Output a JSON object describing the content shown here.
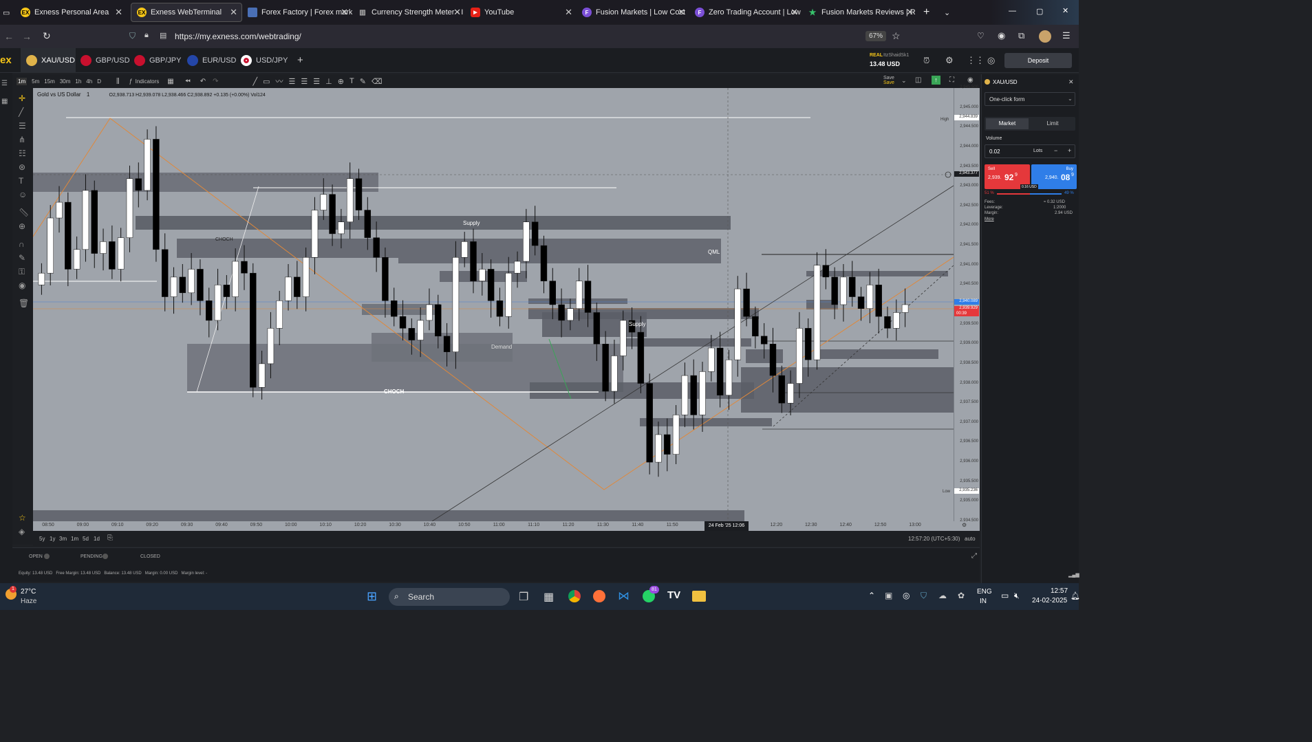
{
  "browser": {
    "tabs": [
      {
        "title": "Exness Personal Area",
        "icon": "exness-icon",
        "active": false
      },
      {
        "title": "Exness WebTerminal",
        "icon": "exness-icon",
        "active": true
      },
      {
        "title": "Forex Factory | Forex marke",
        "icon": "forexfactory-icon",
        "active": false
      },
      {
        "title": "Currency Strength Meter - I",
        "icon": "chart-icon",
        "active": false
      },
      {
        "title": "YouTube",
        "icon": "youtube-icon",
        "active": false
      },
      {
        "title": "Fusion Markets | Low Cost",
        "icon": "fusion-icon",
        "active": false
      },
      {
        "title": "Zero Trading Account | Low",
        "icon": "fusion-icon",
        "active": false
      },
      {
        "title": "Fusion Markets Reviews | R",
        "icon": "star-icon",
        "active": false
      }
    ],
    "url": "https://my.exness.com/webtrading/",
    "zoom": "67%"
  },
  "terminal": {
    "logo": "ex",
    "symbols": [
      "XAU/USD",
      "GBP/USD",
      "GBP/JPY",
      "EUR/USD",
      "USD/JPY"
    ],
    "account_type": "REAL",
    "account_name": "ItzShaidSk1",
    "balance": "13.48 USD",
    "deposit_label": "Deposit"
  },
  "toolbar": {
    "timeframes": [
      "1m",
      "5m",
      "15m",
      "30m",
      "1h",
      "4h",
      "D"
    ],
    "indicators_label": "Indicators",
    "save_label": "Save"
  },
  "legend": {
    "symbol": "Gold vs US Dollar",
    "interval": "1",
    "ohlc": "O2,938.713 H2,939.078 L2,938.466 C2,938.892 +0.135 (+0.00%) Vol124"
  },
  "chart_labels": {
    "supply_1": "Supply",
    "supply_2": "Supply",
    "qml": "QML",
    "choch_1": "CHOCH",
    "choch_2": "CHOCH",
    "demand": "Demand",
    "high_tag": "High",
    "low_tag": "Low"
  },
  "chart_data": {
    "type": "candlestick",
    "symbol": "XAU/USD",
    "interval": "1m",
    "ylim": [
      2934.5,
      2945.5
    ],
    "y_ticks": [
      "2,945.500",
      "2,945.000",
      "2,944.500",
      "2,944.000",
      "2,943.500",
      "2,943.000",
      "2,942.500",
      "2,942.000",
      "2,941.500",
      "2,941.000",
      "2,940.500",
      "2,940.000",
      "2,939.500",
      "2,939.000",
      "2,938.500",
      "2,938.000",
      "2,937.500",
      "2,937.000",
      "2,936.500",
      "2,936.000",
      "2,935.500",
      "2,935.000",
      "2,934.500"
    ],
    "x_ticks": [
      "08:50",
      "09:00",
      "09:10",
      "09:20",
      "09:30",
      "09:40",
      "09:50",
      "10:00",
      "10:10",
      "10:20",
      "10:30",
      "10:40",
      "10:50",
      "11:00",
      "11:10",
      "11:20",
      "11:30",
      "11:40",
      "11:50",
      "12:20",
      "12:30",
      "12:40",
      "12:50",
      "13:00"
    ],
    "crosshair_x_label": "24 Feb '25  12:06",
    "price_tags": {
      "high": "2,944.839",
      "crosshair": "2,943.377",
      "ask": "2,940.089",
      "bid": "2,939.929",
      "countdown": "00:39",
      "low": "2,935.236"
    },
    "close_series": [
      2940.8,
      2942.2,
      2942.6,
      2940.9,
      2941.4,
      2942.9,
      2941.3,
      2941.6,
      2940.9,
      2941.7,
      2943.2,
      2942.9,
      2944.2,
      2941.4,
      2940.2,
      2940.7,
      2940.3,
      2940.9,
      2940.1,
      2939.6,
      2940.5,
      2940.2,
      2941.1,
      2940.8,
      2937.9,
      2938.5,
      2939.4,
      2940.1,
      2940.7,
      2940.2,
      2941.2,
      2942.4,
      2942.8,
      2941.8,
      2942.1,
      2943.2,
      2942.4,
      2941.7,
      2941.2,
      2940.1,
      2939.7,
      2939.4,
      2939.1,
      2939.6,
      2940.0,
      2939.2,
      2938.8,
      2941.2,
      2941.6,
      2940.6,
      2940.9,
      2940.1,
      2939.7,
      2940.8,
      2941.1,
      2942.1,
      2941.5,
      2940.6,
      2940.0,
      2939.6,
      2939.9,
      2940.6,
      2939.8,
      2939.0,
      2937.8,
      2938.7,
      2939.6,
      2939.3,
      2938.0,
      2936.0,
      2936.7,
      2936.2,
      2937.2,
      2938.2,
      2937.2,
      2938.3,
      2938.9,
      2937.7,
      2938.6,
      2940.4,
      2939.7,
      2939.2,
      2939.0,
      2938.2,
      2937.5,
      2938.0,
      2939.4,
      2938.6,
      2941.0,
      2940.7,
      2940.0,
      2940.7,
      2940.2,
      2939.9,
      2940.5,
      2939.7,
      2939.4,
      2939.8,
      2940.0
    ],
    "annotation_zones": [
      "Supply",
      "Supply",
      "QML",
      "Demand",
      "CHOCH",
      "CHOCH"
    ]
  },
  "range_bar": {
    "ranges": [
      "5y",
      "1y",
      "3m",
      "1m",
      "5d",
      "1d"
    ],
    "clock": "12:57:20 (UTC+5:30)",
    "auto_label": "auto"
  },
  "positions": {
    "tabs": [
      "OPEN",
      "PENDING",
      "CLOSED"
    ],
    "summary": "Equity: 13.48 USD   Free Margin: 13.48 USD   Balance: 13.48 USD   Margin: 0.00 USD   Margin level: -"
  },
  "order_panel": {
    "symbol": "XAU/USD",
    "form_type": "One-click form",
    "order_types": [
      "Market",
      "Limit"
    ],
    "volume_label": "Volume",
    "volume_value": "0.02",
    "volume_unit": "Lots",
    "sell_label": "Sell",
    "sell_price": "2,939.92",
    "sell_price_big": "92",
    "sell_price_small": "9",
    "sell_price_prefix": "2,939.",
    "buy_label": "Buy",
    "buy_price_prefix": "2,940.",
    "buy_price_big": "08",
    "buy_price_small": "9",
    "spread": "0.16 USD",
    "sell_pct": "51 %",
    "buy_pct": "49 %",
    "fees_label": "Fees:",
    "fees_value": "≈ 0.32 USD",
    "leverage_label": "Leverage:",
    "leverage_value": "1:2000",
    "margin_label": "Margin:",
    "margin_value": "2.94 USD",
    "more_label": "More"
  },
  "taskbar": {
    "weather_temp": "27°C",
    "weather_desc": "Haze",
    "search_placeholder": "Search",
    "whatsapp_badge": "81",
    "lang_top": "ENG",
    "lang_bottom": "IN",
    "time": "12:57",
    "date": "24-02-2025"
  },
  "colors": {
    "accent_yellow": "#f5c518",
    "sell_red": "#e5383b",
    "buy_blue": "#2f7ee8",
    "chart_bg": "#9fa4ab",
    "candle_up": "#ffffff",
    "candle_down": "#000000",
    "trend_orange": "#e0883a"
  }
}
